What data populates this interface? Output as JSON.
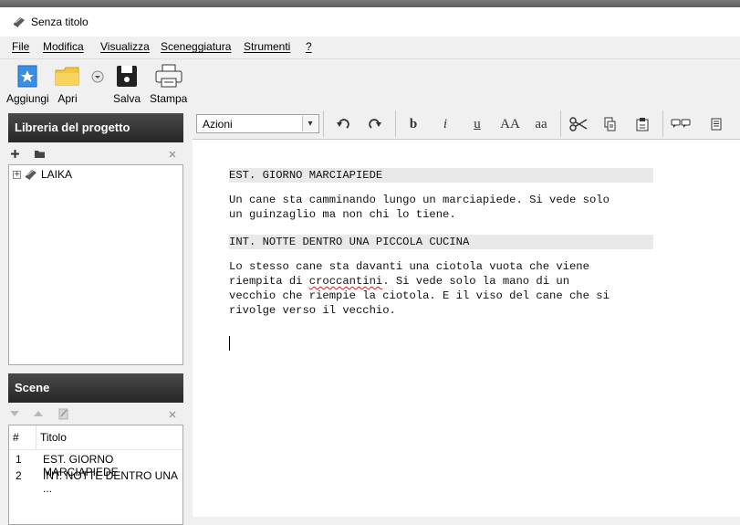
{
  "window": {
    "title": "Senza titolo"
  },
  "menu": [
    "File",
    "Modifica",
    "Visualizza",
    "Sceneggiatura",
    "Strumenti",
    "?"
  ],
  "toolbar": {
    "add_label": "Aggiungi",
    "open_label": "Apri",
    "save_label": "Salva",
    "print_label": "Stampa"
  },
  "library": {
    "title": "Libreria del progetto",
    "items": [
      {
        "label": "LAIKA"
      }
    ]
  },
  "scenes": {
    "title": "Scene",
    "col_num": "#",
    "col_title": "Titolo",
    "rows": [
      {
        "num": "1",
        "title": "EST. GIORNO MARCIAPIEDE"
      },
      {
        "num": "2",
        "title": "INT. NOTTE DENTRO UNA ..."
      }
    ]
  },
  "format_bar": {
    "style_value": "Azioni",
    "bold": "b",
    "italic": "i",
    "underline": "u",
    "upper": "AA",
    "lower": "aa"
  },
  "script": {
    "scene1_heading": "EST. GIORNO MARCIAPIEDE",
    "scene1_action": "Un cane sta camminando lungo un marciapiede. Si vede solo\nun guinzaglio ma non chi lo tiene.",
    "scene2_heading": "INT. NOTTE DENTRO UNA PICCOLA CUCINA",
    "scene2_action_l1": "Lo stesso cane sta davanti una ciotola vuota che viene",
    "scene2_action_l2a": "riempita di ",
    "scene2_action_l2b": "croccantini",
    "scene2_action_l2c": ". Si vede solo la mano di un",
    "scene2_action_l3": "vecchio che riempie la ciotola. E il viso del cane che si\nrivolge verso il vecchio."
  },
  "colors": {
    "panel_header": "#2f2f2f",
    "heading_bg": "#e9e9e9",
    "spell_error": "#d02020",
    "add_button": "#3a8ee6",
    "folder": "#f5c542"
  }
}
